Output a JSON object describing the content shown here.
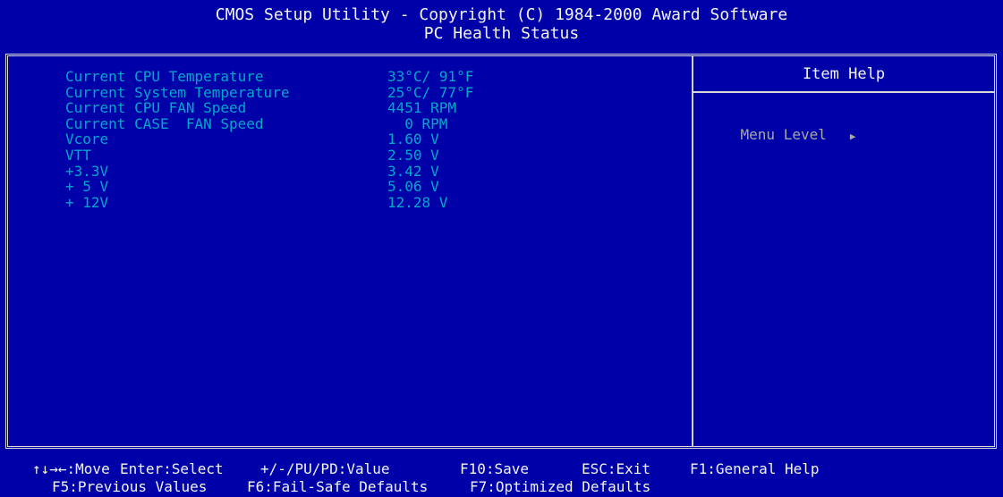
{
  "header": {
    "title_line1": "CMOS Setup Utility - Copyright (C) 1984-2000 Award Software",
    "title_line2": "PC Health Status"
  },
  "main": {
    "items": [
      {
        "label": "Current CPU Temperature",
        "value": "33°C/ 91°F"
      },
      {
        "label": "Current System Temperature",
        "value": "25°C/ 77°F"
      },
      {
        "label": "Current CPU FAN Speed",
        "value": "4451 RPM"
      },
      {
        "label": "Current CASE  FAN Speed",
        "value": "  0 RPM"
      },
      {
        "label": "Vcore",
        "value": "1.60 V"
      },
      {
        "label": "VTT",
        "value": "2.50 V"
      },
      {
        "label": "+3.3V",
        "value": "3.42 V"
      },
      {
        "label": "+ 5 V",
        "value": "5.06 V"
      },
      {
        "label": "+ 12V",
        "value": "12.28 V"
      }
    ]
  },
  "help": {
    "title": "Item Help",
    "menu_level_label": "Menu Level",
    "menu_level_icon": "right-triangle-icon"
  },
  "footer": {
    "line1": [
      {
        "text": "↑↓→←:Move"
      },
      {
        "text": "Enter:Select"
      },
      {
        "text": "+/-/PU/PD:Value"
      },
      {
        "text": "F10:Save"
      },
      {
        "text": "ESC:Exit"
      },
      {
        "text": "F1:General Help"
      }
    ],
    "line2": [
      {
        "text": "F5:Previous Values"
      },
      {
        "text": "F6:Fail-Safe Defaults"
      },
      {
        "text": "F7:Optimized Defaults"
      }
    ]
  },
  "colors": {
    "background": "#0000a8",
    "title_text": "#f4f4f4",
    "item_text": "#00a8c8",
    "help_text": "#a8a8a8",
    "border": "#d8d8d8"
  }
}
